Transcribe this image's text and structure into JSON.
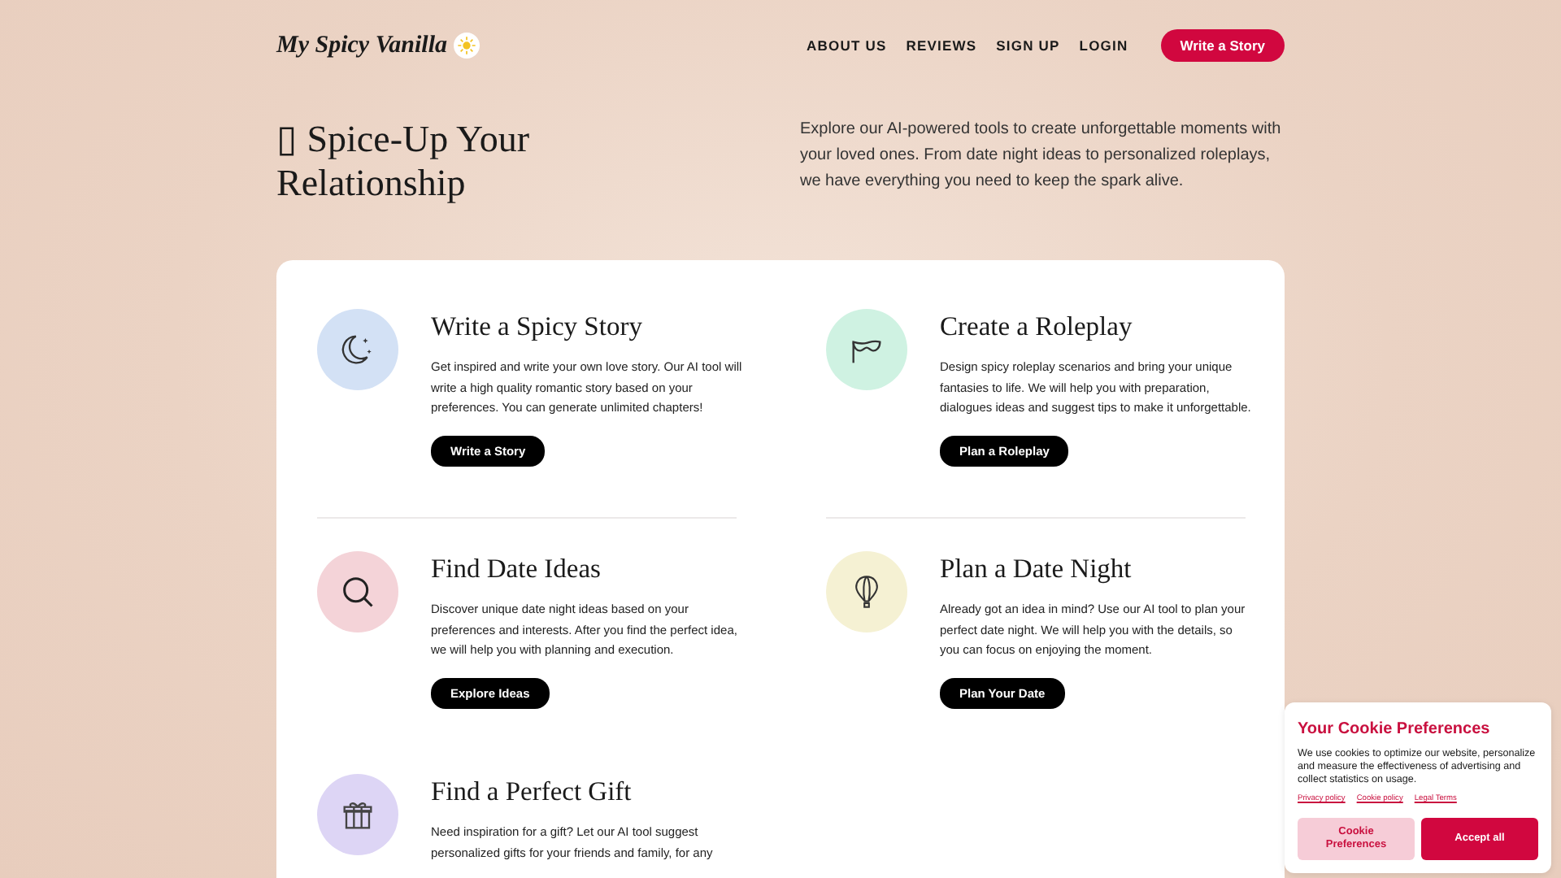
{
  "header": {
    "logo": "My Spicy Vanilla",
    "nav": [
      "ABOUT US",
      "REVIEWS",
      "SIGN UP",
      "LOGIN"
    ],
    "cta": "Write a Story"
  },
  "hero": {
    "title": "▯ Spice-Up Your Relationship",
    "text": "Explore our AI-powered tools to create unforgettable moments with your loved ones. From date night ideas to personalized roleplays, we have everything you need to keep the spark alive."
  },
  "features": [
    {
      "kind": "moon",
      "color": "#d3e1f5",
      "title": "Write a Spicy Story",
      "text": "Get inspired and write your own love story. Our AI tool will write a high quality romantic story based on your preferences. You can generate unlimited chapters!",
      "button": "Write a Story"
    },
    {
      "kind": "mask",
      "color": "#cff2e2",
      "title": "Create a Roleplay",
      "text": "Design spicy roleplay scenarios and bring your unique fantasies to life. We will help you with preparation, dialogues ideas and suggest tips to make it unforgettable.",
      "button": "Plan a Roleplay"
    },
    {
      "kind": "search",
      "color": "#f4d3d8",
      "title": "Find Date Ideas",
      "text": "Discover unique date night ideas based on your preferences and interests. After you find the perfect idea, we will help you with planning and execution.",
      "button": "Explore Ideas"
    },
    {
      "kind": "balloon",
      "color": "#f5f1d3",
      "title": "Plan a Date Night",
      "text": "Already got an idea in mind? Use our AI tool to plan your perfect date night. We will help you with the details, so you can focus on enjoying the moment.",
      "button": "Plan Your Date"
    },
    {
      "kind": "gift",
      "color": "#ddd5f5",
      "title": "Find a Perfect Gift",
      "text": "Need inspiration for a gift? Let our AI tool suggest personalized gifts for your friends and family, for any"
    }
  ],
  "cookie": {
    "title": "Your Cookie Preferences",
    "text": "We use cookies to optimize our website, personalize and measure the effectiveness of advertising and collect statistics on usage.",
    "links": [
      "Privacy policy",
      "Cookie policy",
      "Legal Terms"
    ],
    "buttons": [
      "Cookie Preferences",
      "Accept all"
    ]
  }
}
